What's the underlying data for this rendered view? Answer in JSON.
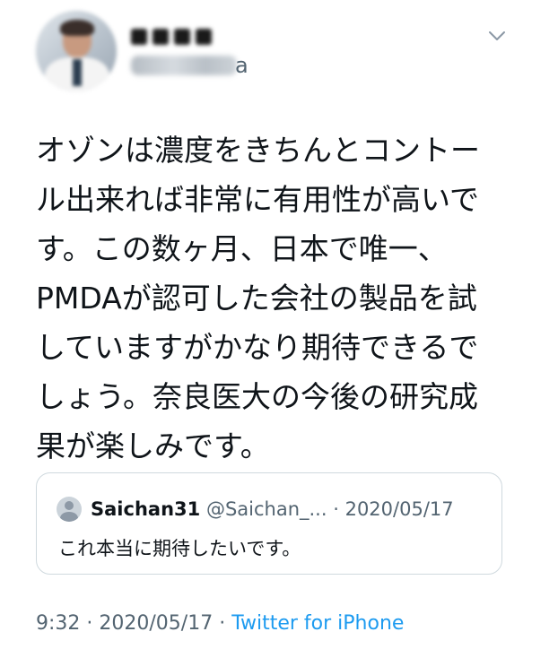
{
  "tweet": {
    "handle_suffix": "a",
    "body": "オゾンは濃度をきちんとコントー\nル出来れば非常に有用性が高いで\nす。この数ヶ月、日本で唯一、\nPMDAが認可した会社の製品を試\nしていますがかなり期待できるで\nしょう。奈良医大の今後の研究成\n果が楽しみです。",
    "quoted": {
      "name": "Saichan31",
      "handle": "@Saichan_...",
      "date_separator": " · ",
      "date": "2020/05/17",
      "text": "これ本当に期待したいです。"
    },
    "meta": {
      "time": "9:32",
      "separator": " · ",
      "date": "2020/05/17",
      "separator2": " · ",
      "source": "Twitter for iPhone"
    }
  },
  "icons": {
    "caret": "chevron-down-icon",
    "avatar": "avatar",
    "quoted_avatar": "default-user-avatar"
  },
  "colors": {
    "text": "#0f1419",
    "secondary": "#536471",
    "link": "#1d9bf0",
    "border": "#cfd9de"
  }
}
